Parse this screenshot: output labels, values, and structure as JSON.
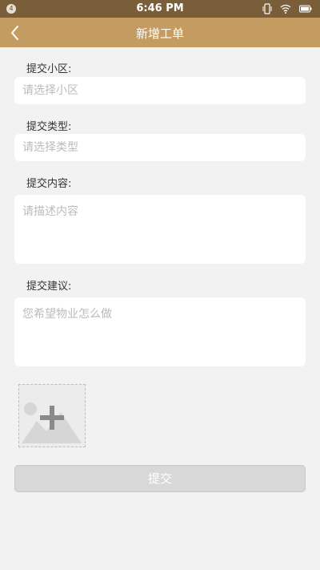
{
  "status_bar": {
    "time": "6:46 PM",
    "notification_count": "4",
    "icons": [
      "vibrate-icon",
      "wifi-icon",
      "battery-icon"
    ]
  },
  "nav": {
    "title": "新增工单",
    "back_icon": "chevron-left-icon"
  },
  "form": {
    "community_label": "提交小区:",
    "community_placeholder": "请选择小区",
    "type_label": "提交类型:",
    "type_placeholder": "请选择类型",
    "content_label": "提交内容:",
    "content_placeholder": "请描述内容",
    "suggestion_label": "提交建议:",
    "suggestion_placeholder": "您希望物业怎么做",
    "upload_icon": "add-image-icon",
    "submit_label": "提交"
  },
  "colors": {
    "status_bar": "#7a5e3a",
    "nav_bar": "#c49c62",
    "background": "#f2f2f2",
    "button_disabled": "#d8d8d8"
  }
}
